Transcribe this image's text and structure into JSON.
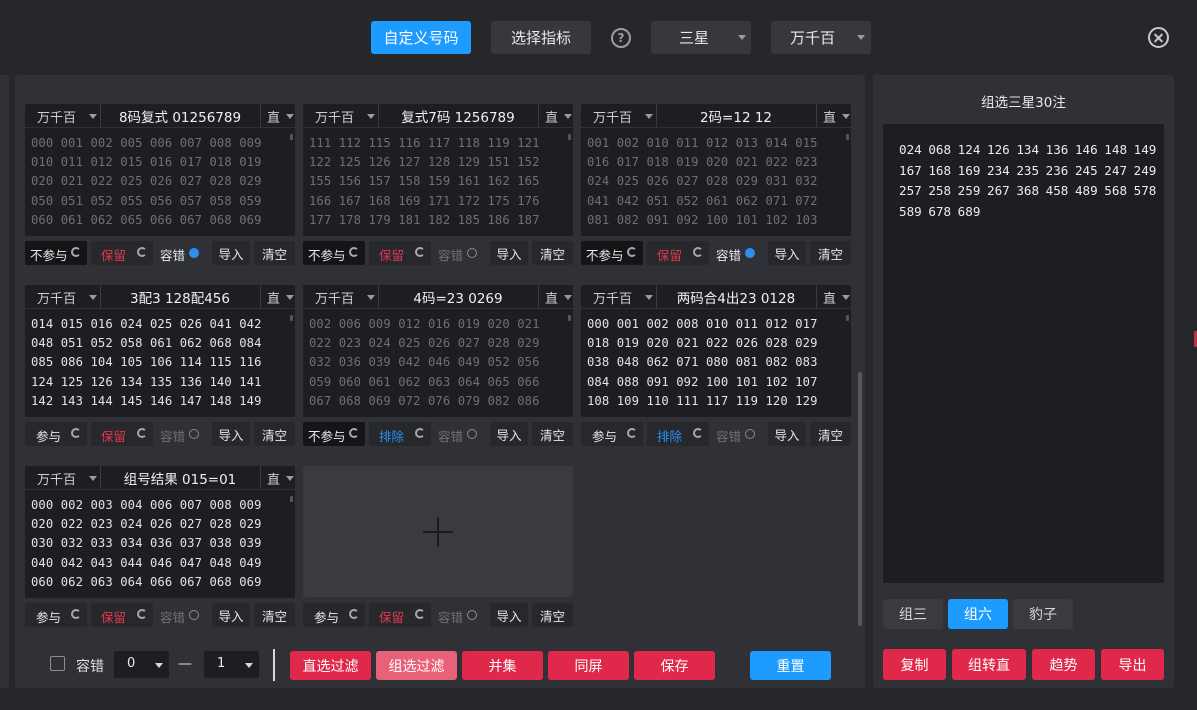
{
  "topbar": {
    "custom_btn": "自定义号码",
    "indicator_btn": "选择指标",
    "help_icon": "?",
    "star_select": "三星",
    "pos_select": "万千百"
  },
  "cards": [
    {
      "pos": "万千百",
      "title": "8码复式 01256789",
      "mode": "直",
      "dim": true,
      "lines": [
        "000 001 002 005 006 007 008 009",
        "010 011 012 015 016 017 018 019",
        "020 021 022 025 026 027 028 029",
        "050 051 052 055 056 057 058 059",
        "060 061 062 065 066 067 068 069"
      ],
      "participate": "不参与",
      "participate_active": true,
      "keep": "保留",
      "keep_color": "red",
      "tolerance": "容错",
      "tolerance_on": true,
      "import": "导入",
      "clear": "清空"
    },
    {
      "pos": "万千百",
      "title": "复式7码 1256789",
      "mode": "直",
      "dim": true,
      "lines": [
        "111 112 115 116 117 118 119 121",
        "122 125 126 127 128 129 151 152",
        "155 156 157 158 159 161 162 165",
        "166 167 168 169 171 172 175 176",
        "177 178 179 181 182 185 186 187"
      ],
      "participate": "不参与",
      "participate_active": true,
      "keep": "保留",
      "keep_color": "red",
      "tolerance": "容错",
      "tolerance_on": false,
      "import": "导入",
      "clear": "清空"
    },
    {
      "pos": "万千百",
      "title": "2码=12 12",
      "mode": "直",
      "dim": true,
      "lines": [
        "001 002 010 011 012 013 014 015",
        "016 017 018 019 020 021 022 023",
        "024 025 026 027 028 029 031 032",
        "041 042 051 052 061 062 071 072",
        "081 082 091 092 100 101 102 103"
      ],
      "participate": "不参与",
      "participate_active": true,
      "keep": "保留",
      "keep_color": "red",
      "tolerance": "容错",
      "tolerance_on": true,
      "import": "导入",
      "clear": "清空"
    },
    {
      "pos": "万千百",
      "title": "3配3 128配456",
      "mode": "直",
      "dim": false,
      "lines": [
        "014 015 016 024 025 026 041 042",
        "048 051 052 058 061 062 068 084",
        "085 086 104 105 106 114 115 116",
        "124 125 126 134 135 136 140 141",
        "142 143 144 145 146 147 148 149"
      ],
      "participate": "参与",
      "participate_active": false,
      "keep": "保留",
      "keep_color": "red",
      "tolerance": "容错",
      "tolerance_on": false,
      "import": "导入",
      "clear": "清空"
    },
    {
      "pos": "万千百",
      "title": "4码=23 0269",
      "mode": "直",
      "dim": true,
      "lines": [
        "002 006 009 012 016 019 020 021",
        "022 023 024 025 026 027 028 029",
        "032 036 039 042 046 049 052 056",
        "059 060 061 062 063 064 065 066",
        "067 068 069 072 076 079 082 086"
      ],
      "participate": "不参与",
      "participate_active": true,
      "keep": "排除",
      "keep_color": "blue",
      "tolerance": "容错",
      "tolerance_on": false,
      "import": "导入",
      "clear": "清空"
    },
    {
      "pos": "万千百",
      "title": "两码合4出23 0128",
      "mode": "直",
      "dim": false,
      "lines": [
        "000 001 002 008 010 011 012 017",
        "018 019 020 021 022 026 028 029",
        "038 048 062 071 080 081 082 083",
        "084 088 091 092 100 101 102 107",
        "108 109 110 111 117 119 120 129"
      ],
      "participate": "参与",
      "participate_active": false,
      "keep": "排除",
      "keep_color": "blue",
      "tolerance": "容错",
      "tolerance_on": false,
      "import": "导入",
      "clear": "清空"
    },
    {
      "pos": "万千百",
      "title": "组号结果 015=01",
      "mode": "直",
      "dim": false,
      "lines": [
        "000 002 003 004 006 007 008 009",
        "020 022 023 024 026 027 028 029",
        "030 032 033 034 036 037 038 039",
        "040 042 043 044 046 047 048 049",
        "060 062 063 064 066 067 068 069"
      ],
      "participate": "参与",
      "participate_active": false,
      "keep": "保留",
      "keep_color": "red",
      "tolerance": "容错",
      "tolerance_on": false,
      "import": "导入",
      "clear": "清空"
    }
  ],
  "add_card_controls": {
    "participate": "参与",
    "keep": "保留",
    "tolerance": "容错",
    "import": "导入",
    "clear": "清空"
  },
  "bottom": {
    "tolerance_label": "容错",
    "from_value": "0",
    "dash": "—",
    "to_value": "1",
    "buttons": {
      "direct_filter": "直选过滤",
      "group_filter": "组选过滤",
      "union": "并集",
      "same_screen": "同屏",
      "save": "保存",
      "reset": "重置"
    }
  },
  "right": {
    "title": "组选三星30注",
    "result": "024 068 124 126 134 136 146 148 149 167 168 169 234 235 236 245 247 249 257 258 259 267 368 458 489 568 578 589 678 689",
    "tabs": [
      "组三",
      "组六",
      "豹子"
    ],
    "active_tab": 1,
    "actions": {
      "copy": "复制",
      "to_direct": "组转直",
      "trend": "趋势",
      "export": "导出"
    }
  },
  "colors": {
    "accent": "#1e9bff",
    "danger": "#e0294a",
    "panel": "#303136",
    "input": "#1d1e21"
  }
}
